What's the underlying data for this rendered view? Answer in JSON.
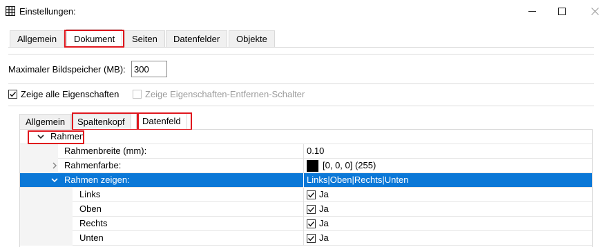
{
  "window": {
    "title": "Einstellungen:",
    "minimize_symbol": "—",
    "maximize_symbol": "☐",
    "close_symbol": "✕"
  },
  "outer_tabs": {
    "items": [
      "Allgemein",
      "Dokument",
      "Seiten",
      "Datenfelder",
      "Objekte"
    ],
    "active": "Dokument"
  },
  "form": {
    "bildspeicher_label": "Maximaler Bildspeicher (MB):",
    "bildspeicher_value": "300",
    "show_all_label": "Zeige alle Eigenschaften",
    "show_all_checked": true,
    "show_remove_label": "Zeige Eigenschaften-Entfernen-Schalter",
    "show_remove_checked": false
  },
  "inner_tabs": {
    "items": [
      "Allgemein",
      "Spaltenkopf",
      "Datenfeld"
    ],
    "active": "Datenfeld"
  },
  "grid": {
    "group": {
      "label": "Rahmen",
      "expanded": true
    },
    "rows": [
      {
        "name": "Rahmenbreite (mm):",
        "value": "0.10"
      },
      {
        "name": "Rahmenfarbe:",
        "value": "[0, 0, 0] (255)",
        "swatch_color": "#000000",
        "expandable": true
      },
      {
        "name": "Rahmen zeigen:",
        "value": "Links|Oben|Rechts|Unten",
        "expanded": true,
        "selected": true
      },
      {
        "name": "Links",
        "value": "Ja",
        "checked": true
      },
      {
        "name": "Oben",
        "value": "Ja",
        "checked": true
      },
      {
        "name": "Rechts",
        "value": "Ja",
        "checked": true
      },
      {
        "name": "Unten",
        "value": "Ja",
        "checked": true
      }
    ]
  },
  "colors": {
    "highlight": "#e0161d",
    "selection": "#0b78d7"
  }
}
